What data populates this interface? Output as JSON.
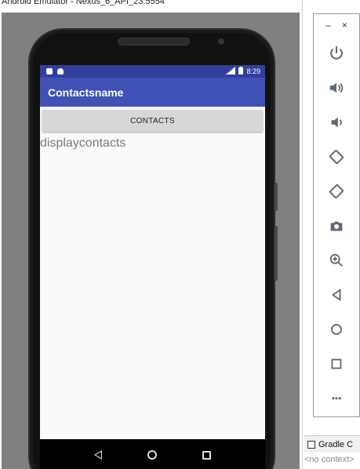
{
  "window": {
    "title": "Android Emulator - Nexus_6_API_23:5554"
  },
  "status_bar": {
    "time": "8:29"
  },
  "app": {
    "title": "Contactsname",
    "contacts_button": "CONTACTS",
    "display_text": "displaycontacts"
  },
  "tool_panel": {
    "minimize": "–",
    "close": "×",
    "more": "•••",
    "buttons": [
      "power-icon",
      "volume-up-icon",
      "volume-down-icon",
      "rotate-left-icon",
      "rotate-right-icon",
      "camera-icon",
      "zoom-icon",
      "back-icon",
      "home-icon",
      "overview-icon",
      "more-icon"
    ]
  },
  "bottom": {
    "gradle_tab": "Gradle C",
    "no_context": "<no context>"
  },
  "colors": {
    "primary": "#3f51b5",
    "primary_dark": "#303f9f"
  }
}
